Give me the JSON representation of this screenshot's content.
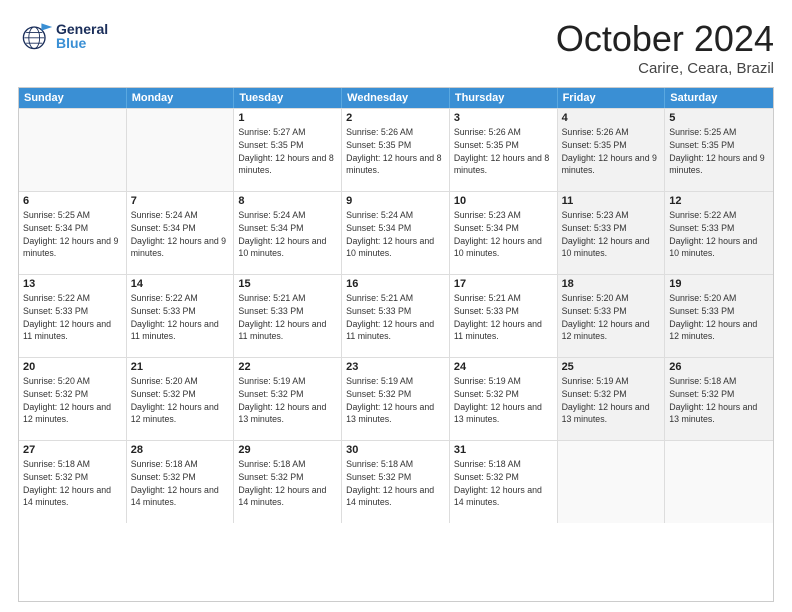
{
  "header": {
    "logo_general": "General",
    "logo_blue": "Blue",
    "month": "October 2024",
    "location": "Carire, Ceara, Brazil"
  },
  "days_of_week": [
    "Sunday",
    "Monday",
    "Tuesday",
    "Wednesday",
    "Thursday",
    "Friday",
    "Saturday"
  ],
  "weeks": [
    [
      {
        "day": "",
        "empty": true
      },
      {
        "day": "",
        "empty": true
      },
      {
        "day": "1",
        "sunrise": "Sunrise: 5:27 AM",
        "sunset": "Sunset: 5:35 PM",
        "daylight": "Daylight: 12 hours and 8 minutes."
      },
      {
        "day": "2",
        "sunrise": "Sunrise: 5:26 AM",
        "sunset": "Sunset: 5:35 PM",
        "daylight": "Daylight: 12 hours and 8 minutes."
      },
      {
        "day": "3",
        "sunrise": "Sunrise: 5:26 AM",
        "sunset": "Sunset: 5:35 PM",
        "daylight": "Daylight: 12 hours and 8 minutes."
      },
      {
        "day": "4",
        "sunrise": "Sunrise: 5:26 AM",
        "sunset": "Sunset: 5:35 PM",
        "daylight": "Daylight: 12 hours and 9 minutes."
      },
      {
        "day": "5",
        "sunrise": "Sunrise: 5:25 AM",
        "sunset": "Sunset: 5:35 PM",
        "daylight": "Daylight: 12 hours and 9 minutes."
      }
    ],
    [
      {
        "day": "6",
        "sunrise": "Sunrise: 5:25 AM",
        "sunset": "Sunset: 5:34 PM",
        "daylight": "Daylight: 12 hours and 9 minutes."
      },
      {
        "day": "7",
        "sunrise": "Sunrise: 5:24 AM",
        "sunset": "Sunset: 5:34 PM",
        "daylight": "Daylight: 12 hours and 9 minutes."
      },
      {
        "day": "8",
        "sunrise": "Sunrise: 5:24 AM",
        "sunset": "Sunset: 5:34 PM",
        "daylight": "Daylight: 12 hours and 10 minutes."
      },
      {
        "day": "9",
        "sunrise": "Sunrise: 5:24 AM",
        "sunset": "Sunset: 5:34 PM",
        "daylight": "Daylight: 12 hours and 10 minutes."
      },
      {
        "day": "10",
        "sunrise": "Sunrise: 5:23 AM",
        "sunset": "Sunset: 5:34 PM",
        "daylight": "Daylight: 12 hours and 10 minutes."
      },
      {
        "day": "11",
        "sunrise": "Sunrise: 5:23 AM",
        "sunset": "Sunset: 5:33 PM",
        "daylight": "Daylight: 12 hours and 10 minutes."
      },
      {
        "day": "12",
        "sunrise": "Sunrise: 5:22 AM",
        "sunset": "Sunset: 5:33 PM",
        "daylight": "Daylight: 12 hours and 10 minutes."
      }
    ],
    [
      {
        "day": "13",
        "sunrise": "Sunrise: 5:22 AM",
        "sunset": "Sunset: 5:33 PM",
        "daylight": "Daylight: 12 hours and 11 minutes."
      },
      {
        "day": "14",
        "sunrise": "Sunrise: 5:22 AM",
        "sunset": "Sunset: 5:33 PM",
        "daylight": "Daylight: 12 hours and 11 minutes."
      },
      {
        "day": "15",
        "sunrise": "Sunrise: 5:21 AM",
        "sunset": "Sunset: 5:33 PM",
        "daylight": "Daylight: 12 hours and 11 minutes."
      },
      {
        "day": "16",
        "sunrise": "Sunrise: 5:21 AM",
        "sunset": "Sunset: 5:33 PM",
        "daylight": "Daylight: 12 hours and 11 minutes."
      },
      {
        "day": "17",
        "sunrise": "Sunrise: 5:21 AM",
        "sunset": "Sunset: 5:33 PM",
        "daylight": "Daylight: 12 hours and 11 minutes."
      },
      {
        "day": "18",
        "sunrise": "Sunrise: 5:20 AM",
        "sunset": "Sunset: 5:33 PM",
        "daylight": "Daylight: 12 hours and 12 minutes."
      },
      {
        "day": "19",
        "sunrise": "Sunrise: 5:20 AM",
        "sunset": "Sunset: 5:33 PM",
        "daylight": "Daylight: 12 hours and 12 minutes."
      }
    ],
    [
      {
        "day": "20",
        "sunrise": "Sunrise: 5:20 AM",
        "sunset": "Sunset: 5:32 PM",
        "daylight": "Daylight: 12 hours and 12 minutes."
      },
      {
        "day": "21",
        "sunrise": "Sunrise: 5:20 AM",
        "sunset": "Sunset: 5:32 PM",
        "daylight": "Daylight: 12 hours and 12 minutes."
      },
      {
        "day": "22",
        "sunrise": "Sunrise: 5:19 AM",
        "sunset": "Sunset: 5:32 PM",
        "daylight": "Daylight: 12 hours and 13 minutes."
      },
      {
        "day": "23",
        "sunrise": "Sunrise: 5:19 AM",
        "sunset": "Sunset: 5:32 PM",
        "daylight": "Daylight: 12 hours and 13 minutes."
      },
      {
        "day": "24",
        "sunrise": "Sunrise: 5:19 AM",
        "sunset": "Sunset: 5:32 PM",
        "daylight": "Daylight: 12 hours and 13 minutes."
      },
      {
        "day": "25",
        "sunrise": "Sunrise: 5:19 AM",
        "sunset": "Sunset: 5:32 PM",
        "daylight": "Daylight: 12 hours and 13 minutes."
      },
      {
        "day": "26",
        "sunrise": "Sunrise: 5:18 AM",
        "sunset": "Sunset: 5:32 PM",
        "daylight": "Daylight: 12 hours and 13 minutes."
      }
    ],
    [
      {
        "day": "27",
        "sunrise": "Sunrise: 5:18 AM",
        "sunset": "Sunset: 5:32 PM",
        "daylight": "Daylight: 12 hours and 14 minutes."
      },
      {
        "day": "28",
        "sunrise": "Sunrise: 5:18 AM",
        "sunset": "Sunset: 5:32 PM",
        "daylight": "Daylight: 12 hours and 14 minutes."
      },
      {
        "day": "29",
        "sunrise": "Sunrise: 5:18 AM",
        "sunset": "Sunset: 5:32 PM",
        "daylight": "Daylight: 12 hours and 14 minutes."
      },
      {
        "day": "30",
        "sunrise": "Sunrise: 5:18 AM",
        "sunset": "Sunset: 5:32 PM",
        "daylight": "Daylight: 12 hours and 14 minutes."
      },
      {
        "day": "31",
        "sunrise": "Sunrise: 5:18 AM",
        "sunset": "Sunset: 5:32 PM",
        "daylight": "Daylight: 12 hours and 14 minutes."
      },
      {
        "day": "",
        "empty": true
      },
      {
        "day": "",
        "empty": true
      }
    ]
  ]
}
